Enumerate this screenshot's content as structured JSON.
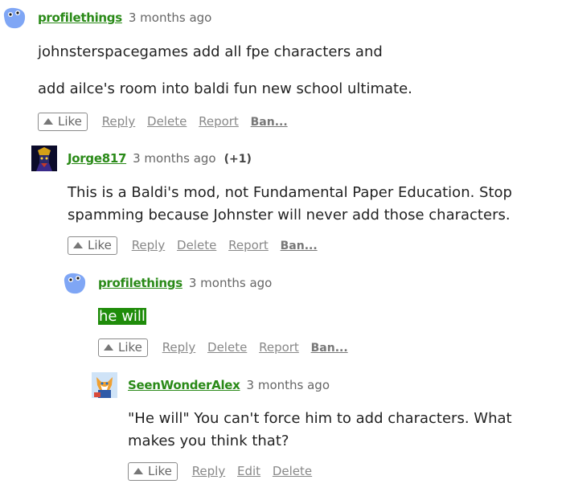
{
  "comments": [
    {
      "author": "profilethings",
      "avatar_icon": "blob-avatar-icon",
      "time": "3 months ago",
      "karma": "",
      "paragraphs": [
        "johnsterspacegames add all fpe characters and",
        "add ailce's room into baldi fun new school ultimate."
      ],
      "actions": {
        "like": "Like",
        "reply": "Reply",
        "delete": "Delete",
        "report": "Report",
        "ban": "Ban..."
      }
    },
    {
      "author": "Jorge817",
      "avatar_icon": "character-avatar-icon",
      "time": "3 months ago",
      "karma": "(+1)",
      "paragraphs": [
        "This is a Baldi's mod, not Fundamental Paper Education. Stop spamming because Johnster will never add those characters."
      ],
      "actions": {
        "like": "Like",
        "reply": "Reply",
        "delete": "Delete",
        "report": "Report",
        "ban": "Ban..."
      }
    },
    {
      "author": "profilethings",
      "avatar_icon": "blob-avatar-icon",
      "time": "3 months ago",
      "karma": "",
      "paragraphs": [
        "he will"
      ],
      "actions": {
        "like": "Like",
        "reply": "Reply",
        "delete": "Delete",
        "report": "Report",
        "ban": "Ban..."
      }
    },
    {
      "author": "SeenWonderAlex",
      "avatar_icon": "fox-avatar-icon",
      "time": "3 months ago",
      "karma": "",
      "paragraphs": [
        "\"He will\" You can't force him to add characters. What makes you think that?"
      ],
      "actions": {
        "like": "Like",
        "reply": "Reply",
        "edit": "Edit",
        "delete": "Delete"
      }
    }
  ],
  "colors": {
    "author_link": "#2a8a18",
    "highlight_bg": "#1f8c0a",
    "muted_text": "#888888"
  }
}
